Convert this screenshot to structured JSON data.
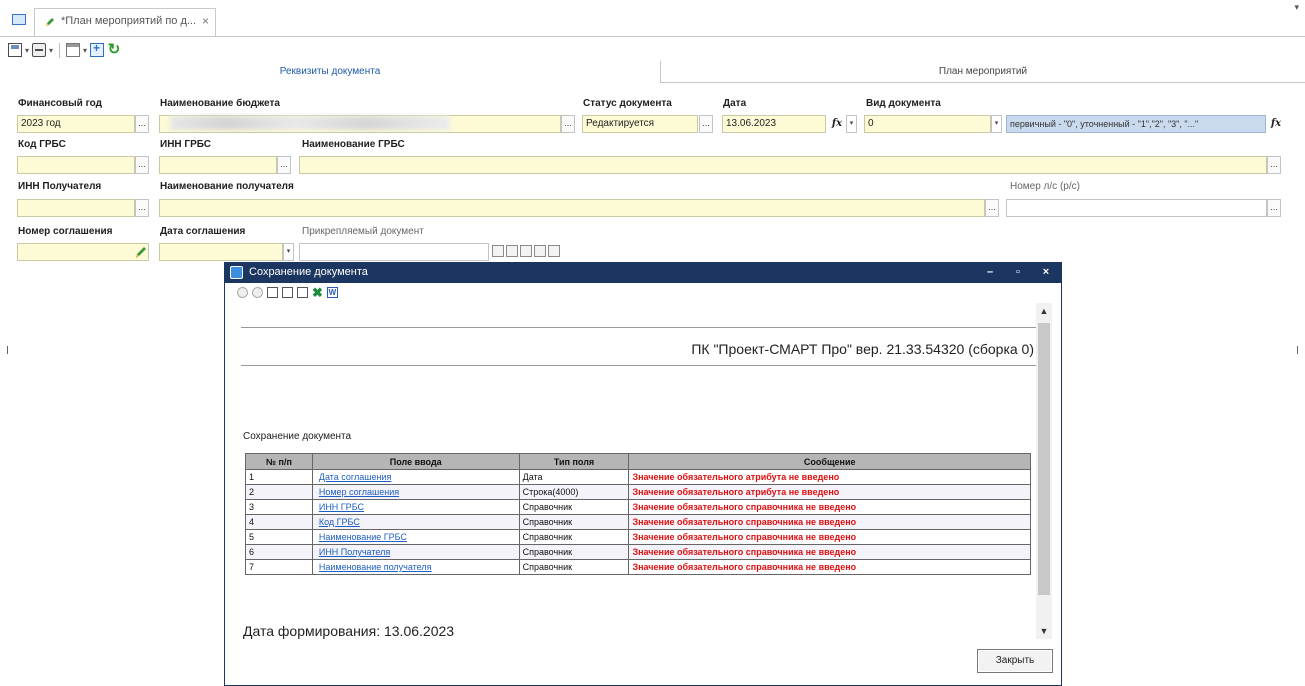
{
  "doc_tab": {
    "title": "*План мероприятий по д...",
    "close": "×"
  },
  "inner_tabs": {
    "active": "Реквизиты документа",
    "inactive": "План мероприятий"
  },
  "form": {
    "fin_year": {
      "label": "Финансовый год",
      "value": "2023 год"
    },
    "budget": {
      "label": "Наименование бюджета",
      "value": ""
    },
    "status": {
      "label": "Статус документа",
      "value": "Редактируется"
    },
    "date": {
      "label": "Дата",
      "value": "13.06.2023"
    },
    "doc_type": {
      "label": "Вид документа",
      "value": "0",
      "hint": "первичный - \"0\", уточненный - \"1\",\"2\", \"3\", \"...\""
    },
    "grbs_code": {
      "label": "Код ГРБС",
      "value": ""
    },
    "grbs_inn": {
      "label": "ИНН ГРБС",
      "value": ""
    },
    "grbs_name": {
      "label": "Наименование ГРБС",
      "value": ""
    },
    "recipient_inn": {
      "label": "ИНН Получателя",
      "value": ""
    },
    "recipient_name": {
      "label": "Наименование получателя",
      "value": ""
    },
    "account": {
      "label": "Номер л/с (р/с)",
      "value": ""
    },
    "agreement_no": {
      "label": "Номер соглашения",
      "value": ""
    },
    "agreement_date": {
      "label": "Дата соглашения",
      "value": ""
    },
    "attachment": {
      "label": "Прикрепляемый документ",
      "value": ""
    }
  },
  "buttons": {
    "dots": "...",
    "fx": "fx",
    "dropdown": "▾"
  },
  "dialog": {
    "title": "Сохранение документа",
    "version": "ПК \"Проект-СМАРТ Про\" вер. 21.33.54320 (сборка 0)",
    "section": "Сохранение документа",
    "columns": [
      "№ п/п",
      "Поле ввода",
      "Тип поля",
      "Сообщение"
    ],
    "rows": [
      {
        "n": "1",
        "field": "Дата соглашения",
        "type": "Дата",
        "msg": "Значение обязательного атрибута не введено"
      },
      {
        "n": "2",
        "field": "Номер соглашения",
        "type": "Строка(4000)",
        "msg": "Значение обязательного атрибута не введено"
      },
      {
        "n": "3",
        "field": "ИНН ГРБС",
        "type": "Справочник",
        "msg": "Значение обязательного справочника не введено"
      },
      {
        "n": "4",
        "field": "Код ГРБС",
        "type": "Справочник",
        "msg": "Значение обязательного справочника не введено"
      },
      {
        "n": "5",
        "field": "Наименование ГРБС",
        "type": "Справочник",
        "msg": "Значение обязательного справочника не введено"
      },
      {
        "n": "6",
        "field": "ИНН Получателя",
        "type": "Справочник",
        "msg": "Значение обязательного справочника не введено"
      },
      {
        "n": "7",
        "field": "Наименование получателя",
        "type": "Справочник",
        "msg": "Значение обязательного справочника не введено"
      }
    ],
    "generated": "Дата формирования: 13.06.2023",
    "close_label": "Закрыть",
    "window_buttons": {
      "minimize": "–",
      "maximize": "▫",
      "close": "×"
    }
  },
  "colors": {
    "title_bar": "#1c3662",
    "field_yellow": "#fdfbd6",
    "error_red": "#e01010",
    "link_blue": "#1f5fc1"
  }
}
